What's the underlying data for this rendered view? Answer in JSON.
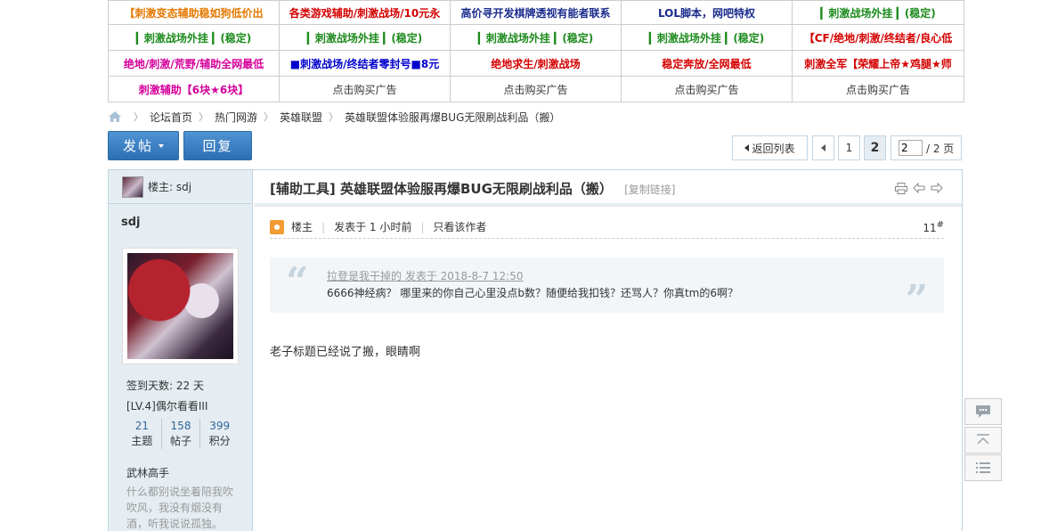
{
  "ads": [
    [
      {
        "text": "【刺激变态辅助稳如狗低价出",
        "color": "#e47800"
      },
      {
        "text": "各类游戏辅助/刺激战场/10元永",
        "color": "#d40000"
      },
      {
        "text": "高价寻开发棋牌透视有能者联系",
        "color": "#1a2c8c"
      },
      {
        "text": "LOL脚本，网吧特权",
        "color": "#1a2c8c"
      },
      {
        "text": "▎刺激战场外挂 ▎(稳定)",
        "color": "#1d8b1d"
      }
    ],
    [
      {
        "text": "▎刺激战场外挂 ▎(稳定)",
        "color": "#1d8b1d"
      },
      {
        "text": "▎刺激战场外挂 ▎(稳定)",
        "color": "#1d8b1d"
      },
      {
        "text": "▎刺激战场外挂 ▎(稳定)",
        "color": "#1d8b1d"
      },
      {
        "text": "▎刺激战场外挂 ▎(稳定)",
        "color": "#1d8b1d"
      },
      {
        "text": "【CF/绝地/刺激/终结者/良心低",
        "color": "#d40000"
      }
    ],
    [
      {
        "text": "绝地/刺激/荒野/辅助全网最低",
        "color": "#d4009a"
      },
      {
        "text": "■刺激战场/终结者零封号■8元",
        "color": "#0000cc"
      },
      {
        "text": "绝地求生/刺激战场",
        "color": "#d40000"
      },
      {
        "text": "稳定奔放/全网最低",
        "color": "#d40000"
      },
      {
        "text": "刺激全军【荣耀上帝★鸡腿★师",
        "color": "#d40000"
      }
    ],
    [
      {
        "text": "刺激辅助【6块★6块】",
        "color": "#d4009a"
      },
      {
        "text": "点击购买广告",
        "color": "#333333"
      },
      {
        "text": "点击购买广告",
        "color": "#333333"
      },
      {
        "text": "点击购买广告",
        "color": "#333333"
      },
      {
        "text": "点击购买广告",
        "color": "#333333"
      }
    ]
  ],
  "breadcrumb": {
    "home_icon": "home-icon",
    "items": [
      "论坛首页",
      "热门网游",
      "英雄联盟",
      "英雄联盟体验服再爆BUG无限刷战利品（搬）"
    ]
  },
  "actions": {
    "post_label": "发帖",
    "reply_label": "回复"
  },
  "pager": {
    "back_label": "返回列表",
    "pages": [
      "1",
      "2"
    ],
    "current_page": "2",
    "jump_value": "2",
    "total_label": "/ 2 页"
  },
  "author": {
    "lz_label": "楼主: sdj",
    "name": "sdj",
    "sign_days": "签到天数: 22 天",
    "level": "[LV.4]偶尔看看III",
    "stats": [
      {
        "value": "21",
        "label": "主题"
      },
      {
        "value": "158",
        "label": "帖子"
      },
      {
        "value": "399",
        "label": "积分"
      }
    ],
    "rank": "武林高手",
    "motto": "什么都别说坐着陪我吹吹风，我没有烟没有酒，听我说说孤独。"
  },
  "post": {
    "category": "[辅助工具]",
    "title": "英雄联盟体验服再爆BUG无限刷战利品（搬）",
    "copy_link": "[复制链接]",
    "role": "楼主",
    "posted": "发表于 1 小时前",
    "only_author": "只看该作者",
    "floor": "11",
    "floor_mark": "#",
    "quote_header": "拉登是我干掉的 发表于 2018-8-7 12:50",
    "quote_body": "6666神经病？ 哪里来的你自己心里没点b数？随便给我扣钱？还骂人？你真tm的6啊？",
    "body": "老子标题已经说了搬，眼睛啊"
  }
}
